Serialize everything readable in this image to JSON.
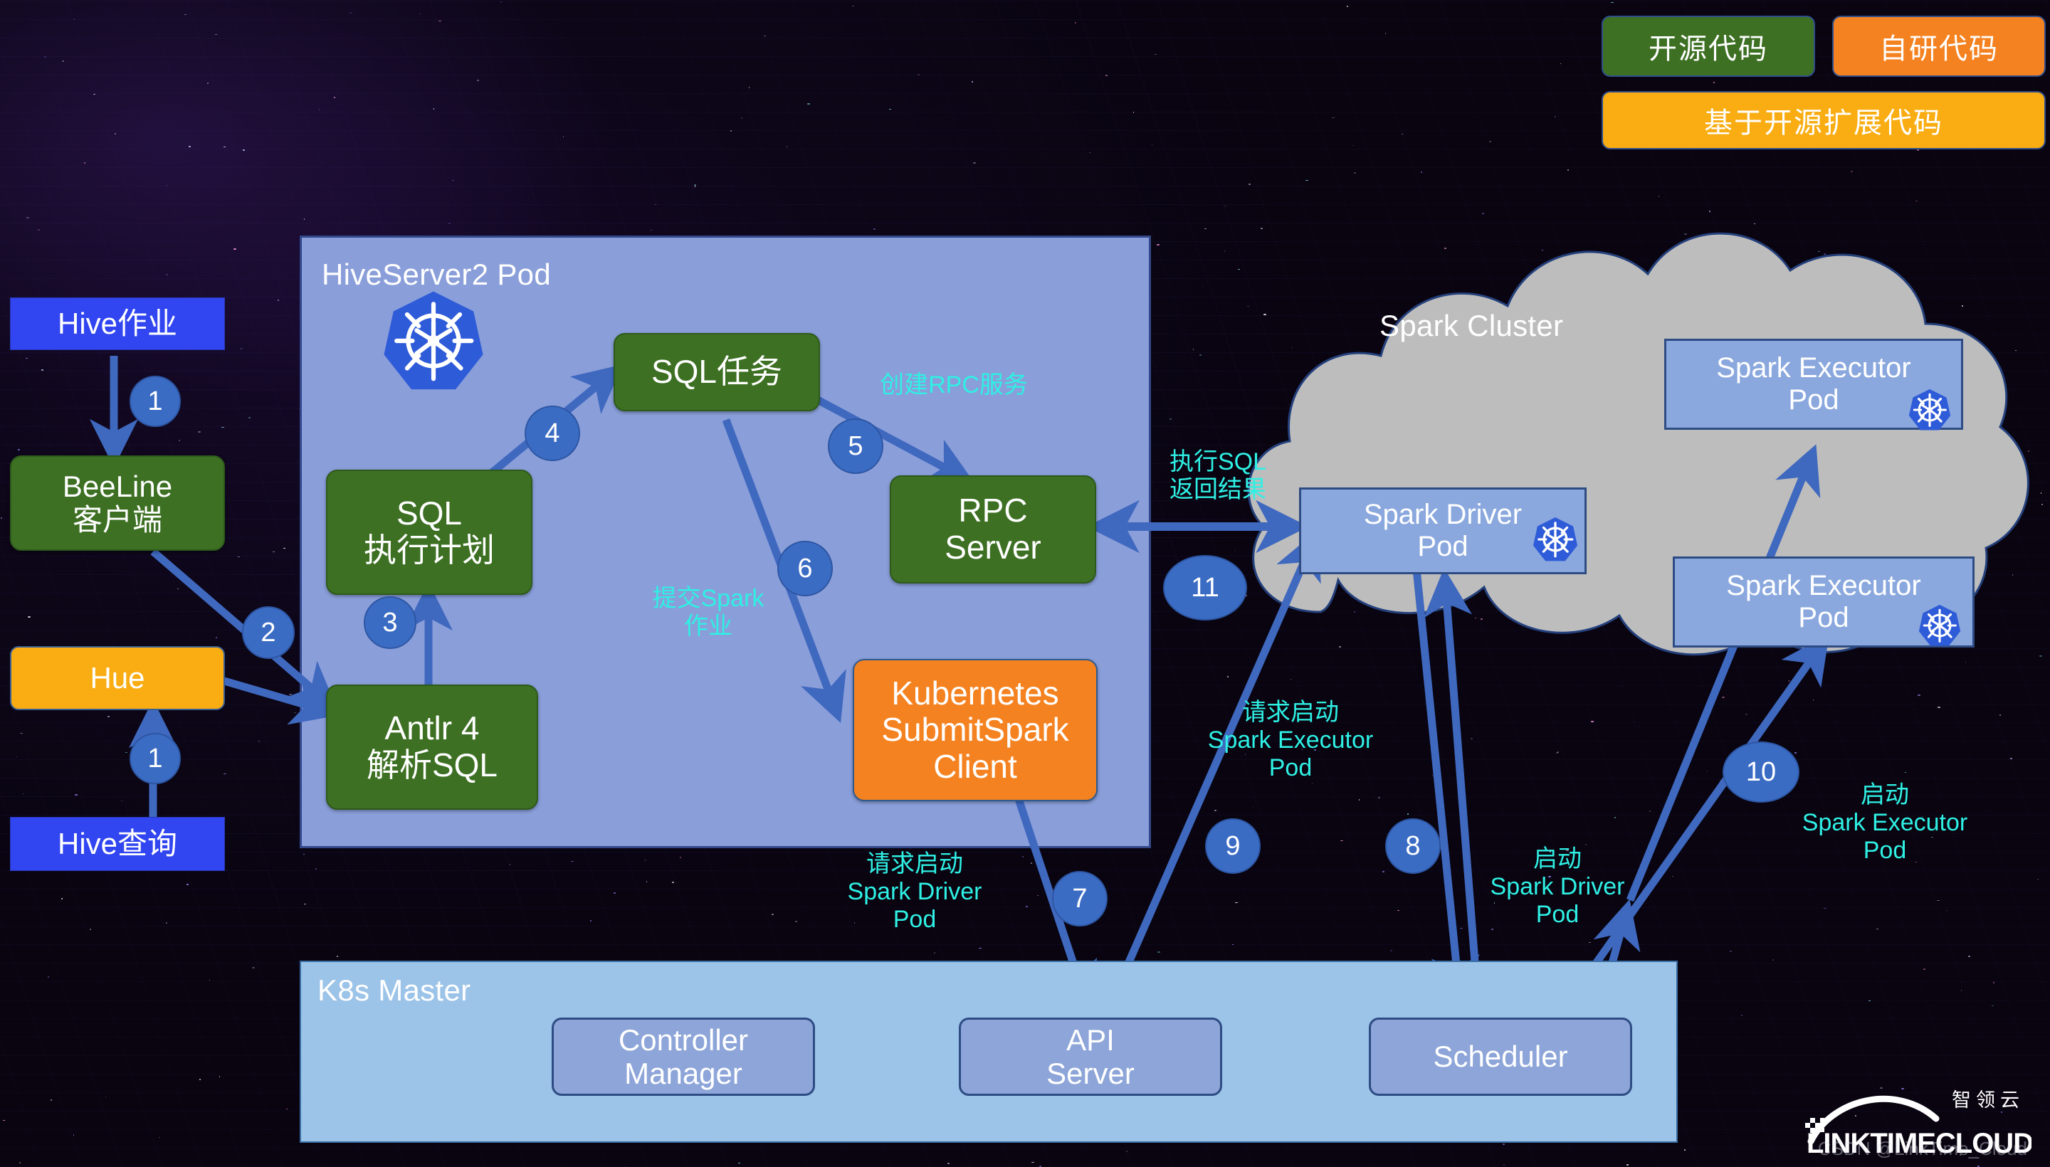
{
  "legend": {
    "items": [
      {
        "label": "开源代码",
        "color": "#3d7023",
        "name": "open-source-code"
      },
      {
        "label": "自研代码",
        "color": "#f58220",
        "name": "self-developed-code"
      },
      {
        "label": "基于开源扩展代码",
        "color": "#f9ad12",
        "name": "extended-open-source-code"
      }
    ]
  },
  "left_column": {
    "hive_job": "Hive作业",
    "beeline_client": "BeeLine\n客户端",
    "hue": "Hue",
    "hive_query": "Hive查询"
  },
  "hiveserver2_pod": {
    "title": "HiveServer2 Pod",
    "icon": "kubernetes-icon",
    "nodes": {
      "sql_plan": "SQL\n执行计划",
      "antlr": "Antlr 4\n解析SQL",
      "sql_task": "SQL任务",
      "rpc_server": "RPC\nServer",
      "k8s_submit_client": "Kubernetes\nSubmitSpark\nClient"
    }
  },
  "spark_cluster": {
    "title": "Spark Cluster",
    "driver_pod": "Spark Driver\nPod",
    "executor_pod_1": "Spark Executor\nPod",
    "executor_pod_2": "Spark Executor\nPod"
  },
  "k8s_master": {
    "title": "K8s Master",
    "controller_manager": "Controller\nManager",
    "api_server": "API\nServer",
    "scheduler": "Scheduler"
  },
  "annotations": {
    "create_rpc_service": "创建RPC服务",
    "submit_spark_job": "提交Spark\n作业",
    "exec_sql_return": "执行SQL\n返回结果",
    "request_start_driver": "请求启动\nSpark Driver\nPod",
    "request_start_executor": "请求启动\nSpark Executor\nPod",
    "start_driver": "启动\nSpark Driver\nPod",
    "start_executor": "启动\nSpark Executor\nPod"
  },
  "steps": {
    "s1a": "1",
    "s1b": "1",
    "s2": "2",
    "s3": "3",
    "s4": "4",
    "s5": "5",
    "s6": "6",
    "s7": "7",
    "s8": "8",
    "s9": "9",
    "s10": "10",
    "s11": "11"
  },
  "logo": {
    "wordmark": "LINKTIMECLOUD",
    "chinese": "智领云",
    "watermark": "CSDN @LinkTime_Cloud"
  },
  "colors": {
    "green": "#3d7023",
    "orange": "#f58220",
    "yellow": "#f9ad12",
    "pod_blue": "#8a9ed9",
    "k8s_master_blue": "#9cc3e8",
    "cloud_gray": "#bdbdbd",
    "arrow_blue": "#3f68bf",
    "annotation_cyan": "#2ff0e4",
    "background": "#0a0612"
  }
}
